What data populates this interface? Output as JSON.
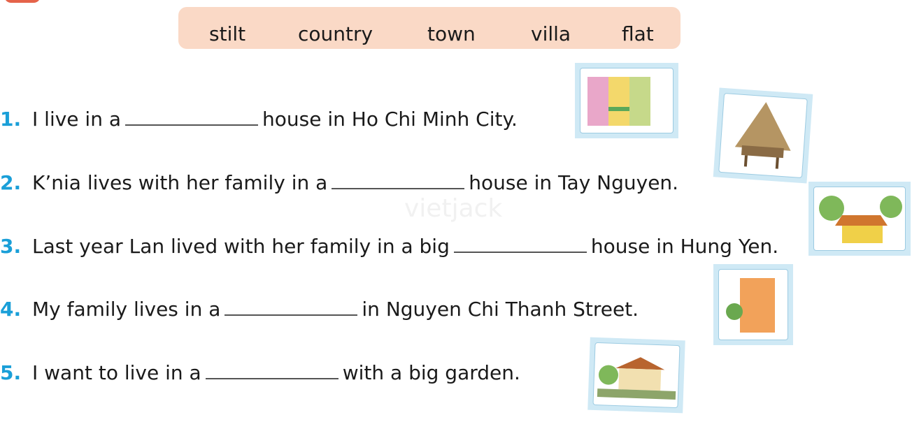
{
  "word_box": [
    "stilt",
    "country",
    "town",
    "villa",
    "flat"
  ],
  "watermark": "vietjack",
  "questions": [
    {
      "num": "1.",
      "before": "I live in a",
      "after": "house in Ho Chi Minh City."
    },
    {
      "num": "2.",
      "before": "K’nia lives with her family in a",
      "after": "house in Tay Nguyen."
    },
    {
      "num": "3.",
      "before": "Last year Lan lived with her family in a big",
      "after": "house in Hung Yen."
    },
    {
      "num": "4.",
      "before": "My family lives in a",
      "after": "in Nguyen Chi Thanh Street."
    },
    {
      "num": "5.",
      "before": "I want to live in a",
      "after": "with a big garden."
    }
  ],
  "colors": {
    "accent": "#1a9fd8",
    "word_box": "#fad9c6",
    "tab": "#e5634a"
  }
}
